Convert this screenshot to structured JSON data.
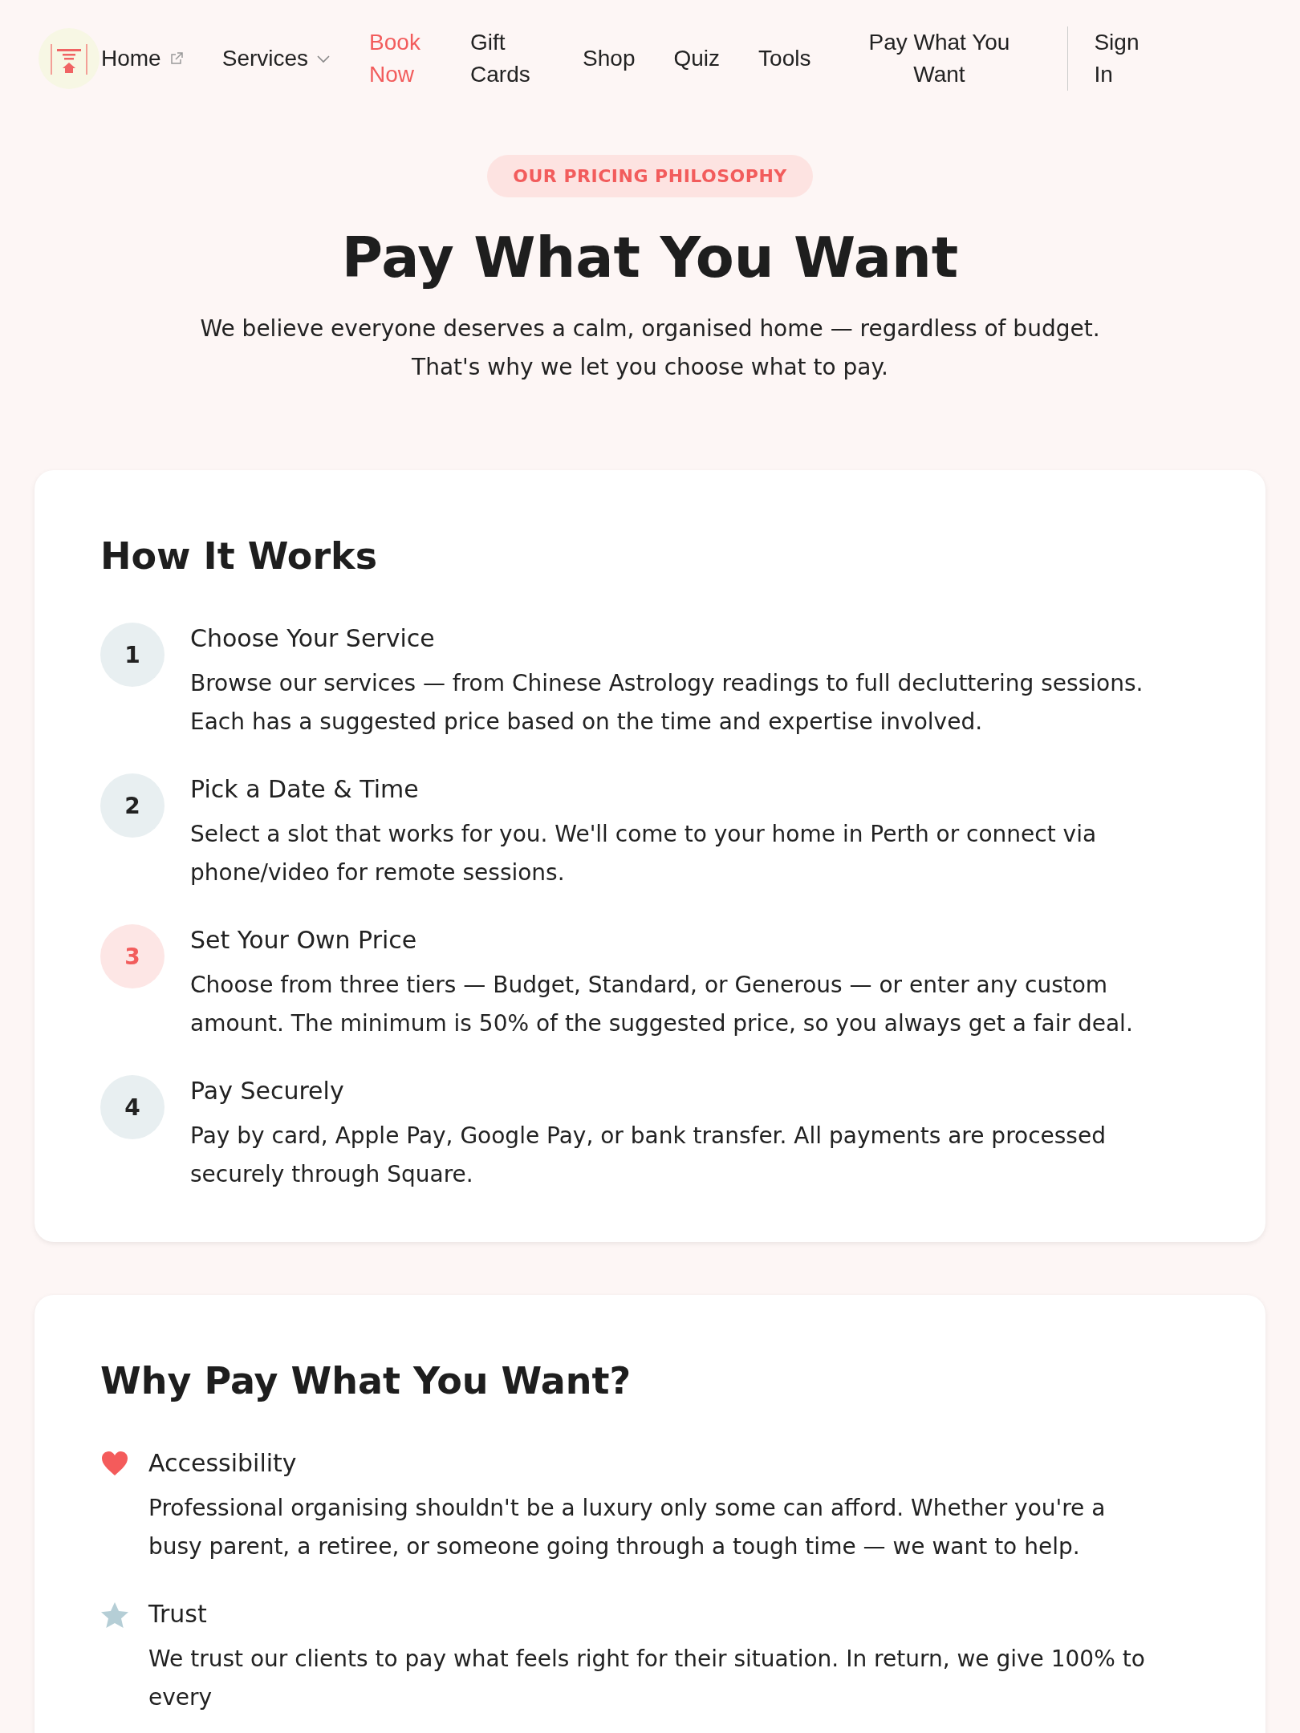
{
  "nav": {
    "items": [
      {
        "label": "Home",
        "kind": "external"
      },
      {
        "label": "Services",
        "kind": "dropdown"
      },
      {
        "label": "Book Now",
        "kind": "accent"
      },
      {
        "label": "Gift Cards",
        "kind": "plain"
      },
      {
        "label": "Shop",
        "kind": "plain"
      },
      {
        "label": "Quiz",
        "kind": "plain"
      },
      {
        "label": "Tools",
        "kind": "plain"
      },
      {
        "label": "Pay What You Want",
        "kind": "plain"
      }
    ],
    "sign_in": "Sign In"
  },
  "hero": {
    "badge": "OUR PRICING PHILOSOPHY",
    "title": "Pay What You Want",
    "subtitle": [
      "We believe everyone deserves a calm, organised home — regardless of budget.",
      "That's why we let you choose what to pay."
    ]
  },
  "how_it_works": {
    "heading": "How It Works",
    "steps": [
      {
        "number": "1",
        "title": "Choose Your Service",
        "text": "Browse our services — from Chinese Astrology readings to full decluttering sessions. Each has a suggested price based on the time and expertise involved.",
        "highlighted": false
      },
      {
        "number": "2",
        "title": "Pick a Date & Time",
        "text": "Select a slot that works for you. We'll come to your home in Perth or connect via phone/video for remote sessions.",
        "highlighted": false
      },
      {
        "number": "3",
        "title": "Set Your Own Price",
        "text": "Choose from three tiers — Budget, Standard, or Generous — or enter any custom amount. The minimum is 50% of the suggested price, so you always get a fair deal.",
        "highlighted": true
      },
      {
        "number": "4",
        "title": "Pay Securely",
        "text": "Pay by card, Apple Pay, Google Pay, or bank transfer. All payments are processed securely through Square.",
        "highlighted": false
      }
    ]
  },
  "why": {
    "heading": "Why Pay What You Want?",
    "reasons": [
      {
        "kind": "heart",
        "title": "Accessibility",
        "text": "Professional organising shouldn't be a luxury only some can afford. Whether you're a busy parent, a retiree, or someone going through a tough time — we want to help."
      },
      {
        "kind": "star",
        "title": "Trust",
        "text": "We trust our clients to pay what feels right for their situation. In return, we give 100% to every"
      }
    ]
  }
}
